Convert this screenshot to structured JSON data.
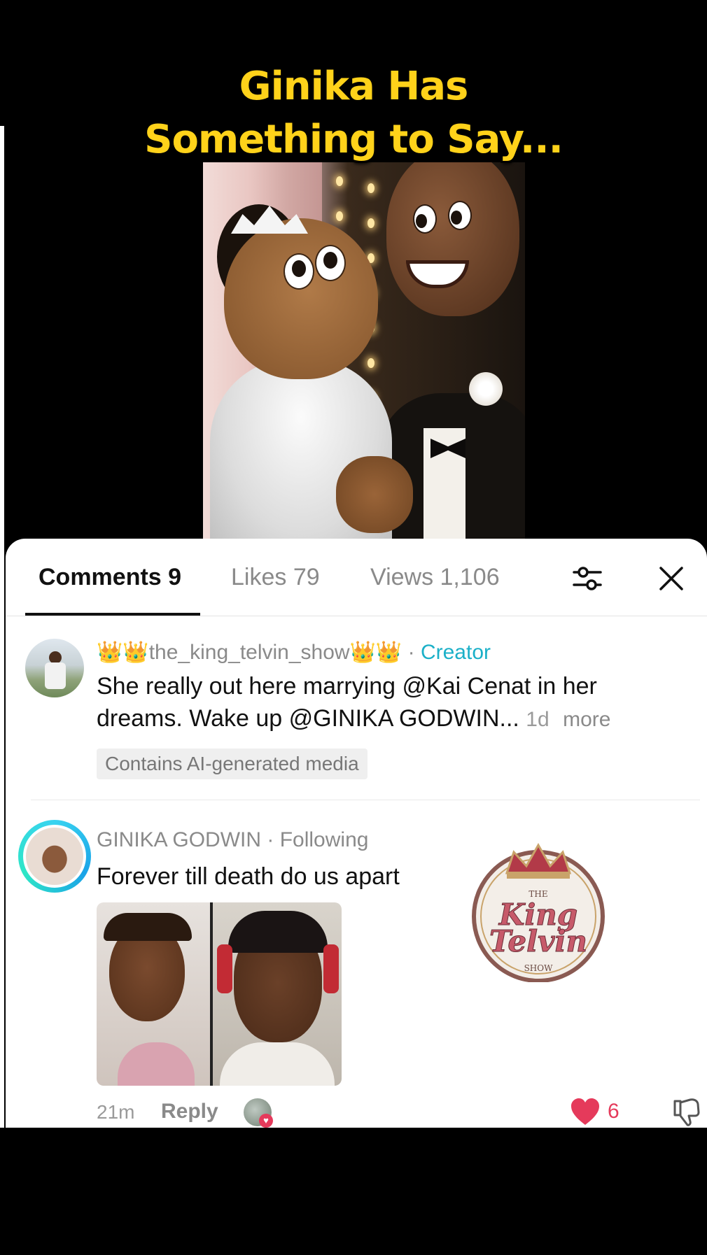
{
  "video": {
    "caption_line1": "Ginika Has",
    "caption_line2": "Something to Say..."
  },
  "tabs": [
    {
      "label": "Comments 9",
      "active": true
    },
    {
      "label": "Likes 79",
      "active": false
    },
    {
      "label": "Views 1,106",
      "active": false
    }
  ],
  "header_icons": {
    "filter": "sliders-icon",
    "close": "close-icon"
  },
  "comments": [
    {
      "username": "👑👑the_king_telvin_show👑👑",
      "separator": "·",
      "tag": "Creator",
      "text_line1": "She really out here marrying @Kai Cenat in her",
      "text_line2": "dreams. Wake up @GINIKA GODWIN...",
      "time": "1d",
      "more": "more",
      "badge": "Contains AI-generated media"
    },
    {
      "username": "GINIKA GODWIN",
      "separator": "·",
      "tag": "Following",
      "text": "Forever till death do us apart",
      "time": "21m",
      "reply": "Reply",
      "likes": "6"
    }
  ],
  "logo": {
    "top": "THE",
    "line1": "King",
    "line2": "Telvin",
    "bottom": "SHOW"
  },
  "colors": {
    "caption": "#FFD21A",
    "creator_tag": "#1bb0c8",
    "like": "#e53a5b"
  }
}
